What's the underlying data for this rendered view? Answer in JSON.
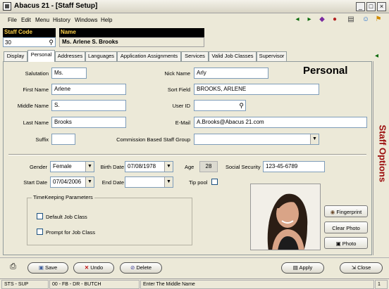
{
  "window": {
    "title": "Abacus 21 - [Staff Setup]"
  },
  "menu": [
    "File",
    "Edit",
    "Menu",
    "History",
    "Windows",
    "Help"
  ],
  "staff": {
    "code_header": "Staff Code",
    "code_value": "30",
    "name_header": "Name",
    "name_value": "Ms. Arlene S. Brooks"
  },
  "tabs": [
    "Display",
    "Personal",
    "Addresses",
    "Languages",
    "Application Assignments",
    "Services",
    "Valid Job Classes",
    "Supervisor"
  ],
  "active_tab": "Personal",
  "section_title": "Personal",
  "form": {
    "salutation_label": "Salutation",
    "salutation_value": "Ms.",
    "nickname_label": "Nick Name",
    "nickname_value": "Arly",
    "first_name_label": "First Name",
    "first_name_value": "Arlene",
    "sort_field_label": "Sort Field",
    "sort_field_value": "BROOKS, ARLENE",
    "middle_name_label": "Middle Name",
    "middle_name_value": "S.",
    "user_id_label": "User ID",
    "user_id_value": "",
    "last_name_label": "Last Name",
    "last_name_value": "Brooks",
    "email_label": "E-Mail",
    "email_value": "A.Brooks@Abacus 21.com",
    "suffix_label": "Suffix",
    "suffix_value": "",
    "commission_label": "Commission Based Staff Group",
    "commission_value": "",
    "gender_label": "Gender",
    "gender_value": "Female",
    "birth_date_label": "Birth Date",
    "birth_date_value": "07/08/1978",
    "age_label": "Age",
    "age_value": "28",
    "ssn_label": "Social Security",
    "ssn_value": "123-45-6789",
    "start_date_label": "Start Date",
    "start_date_value": "07/04/2006",
    "end_date_label": "End Date",
    "end_date_value": "",
    "tip_pool_label": "Tip pool",
    "timekeeping_label": "TimeKeeping Parameters",
    "default_job_class_label": "Default Job Class",
    "prompt_job_class_label": "Prompt for Job Class"
  },
  "photo_buttons": {
    "fingerprint": "Fingerprint",
    "clear_photo": "Clear Photo",
    "photo": "Photo"
  },
  "sidebar_label": "Staff Options",
  "actions": {
    "save": "Save",
    "undo": "Undo",
    "delete": "Delete",
    "apply": "Apply",
    "close": "Close"
  },
  "status": {
    "s1": "STS - SUP",
    "s2": "00 - FB - DR - BUTCH",
    "s3": "Enter The Middle Name",
    "s4": "1"
  }
}
